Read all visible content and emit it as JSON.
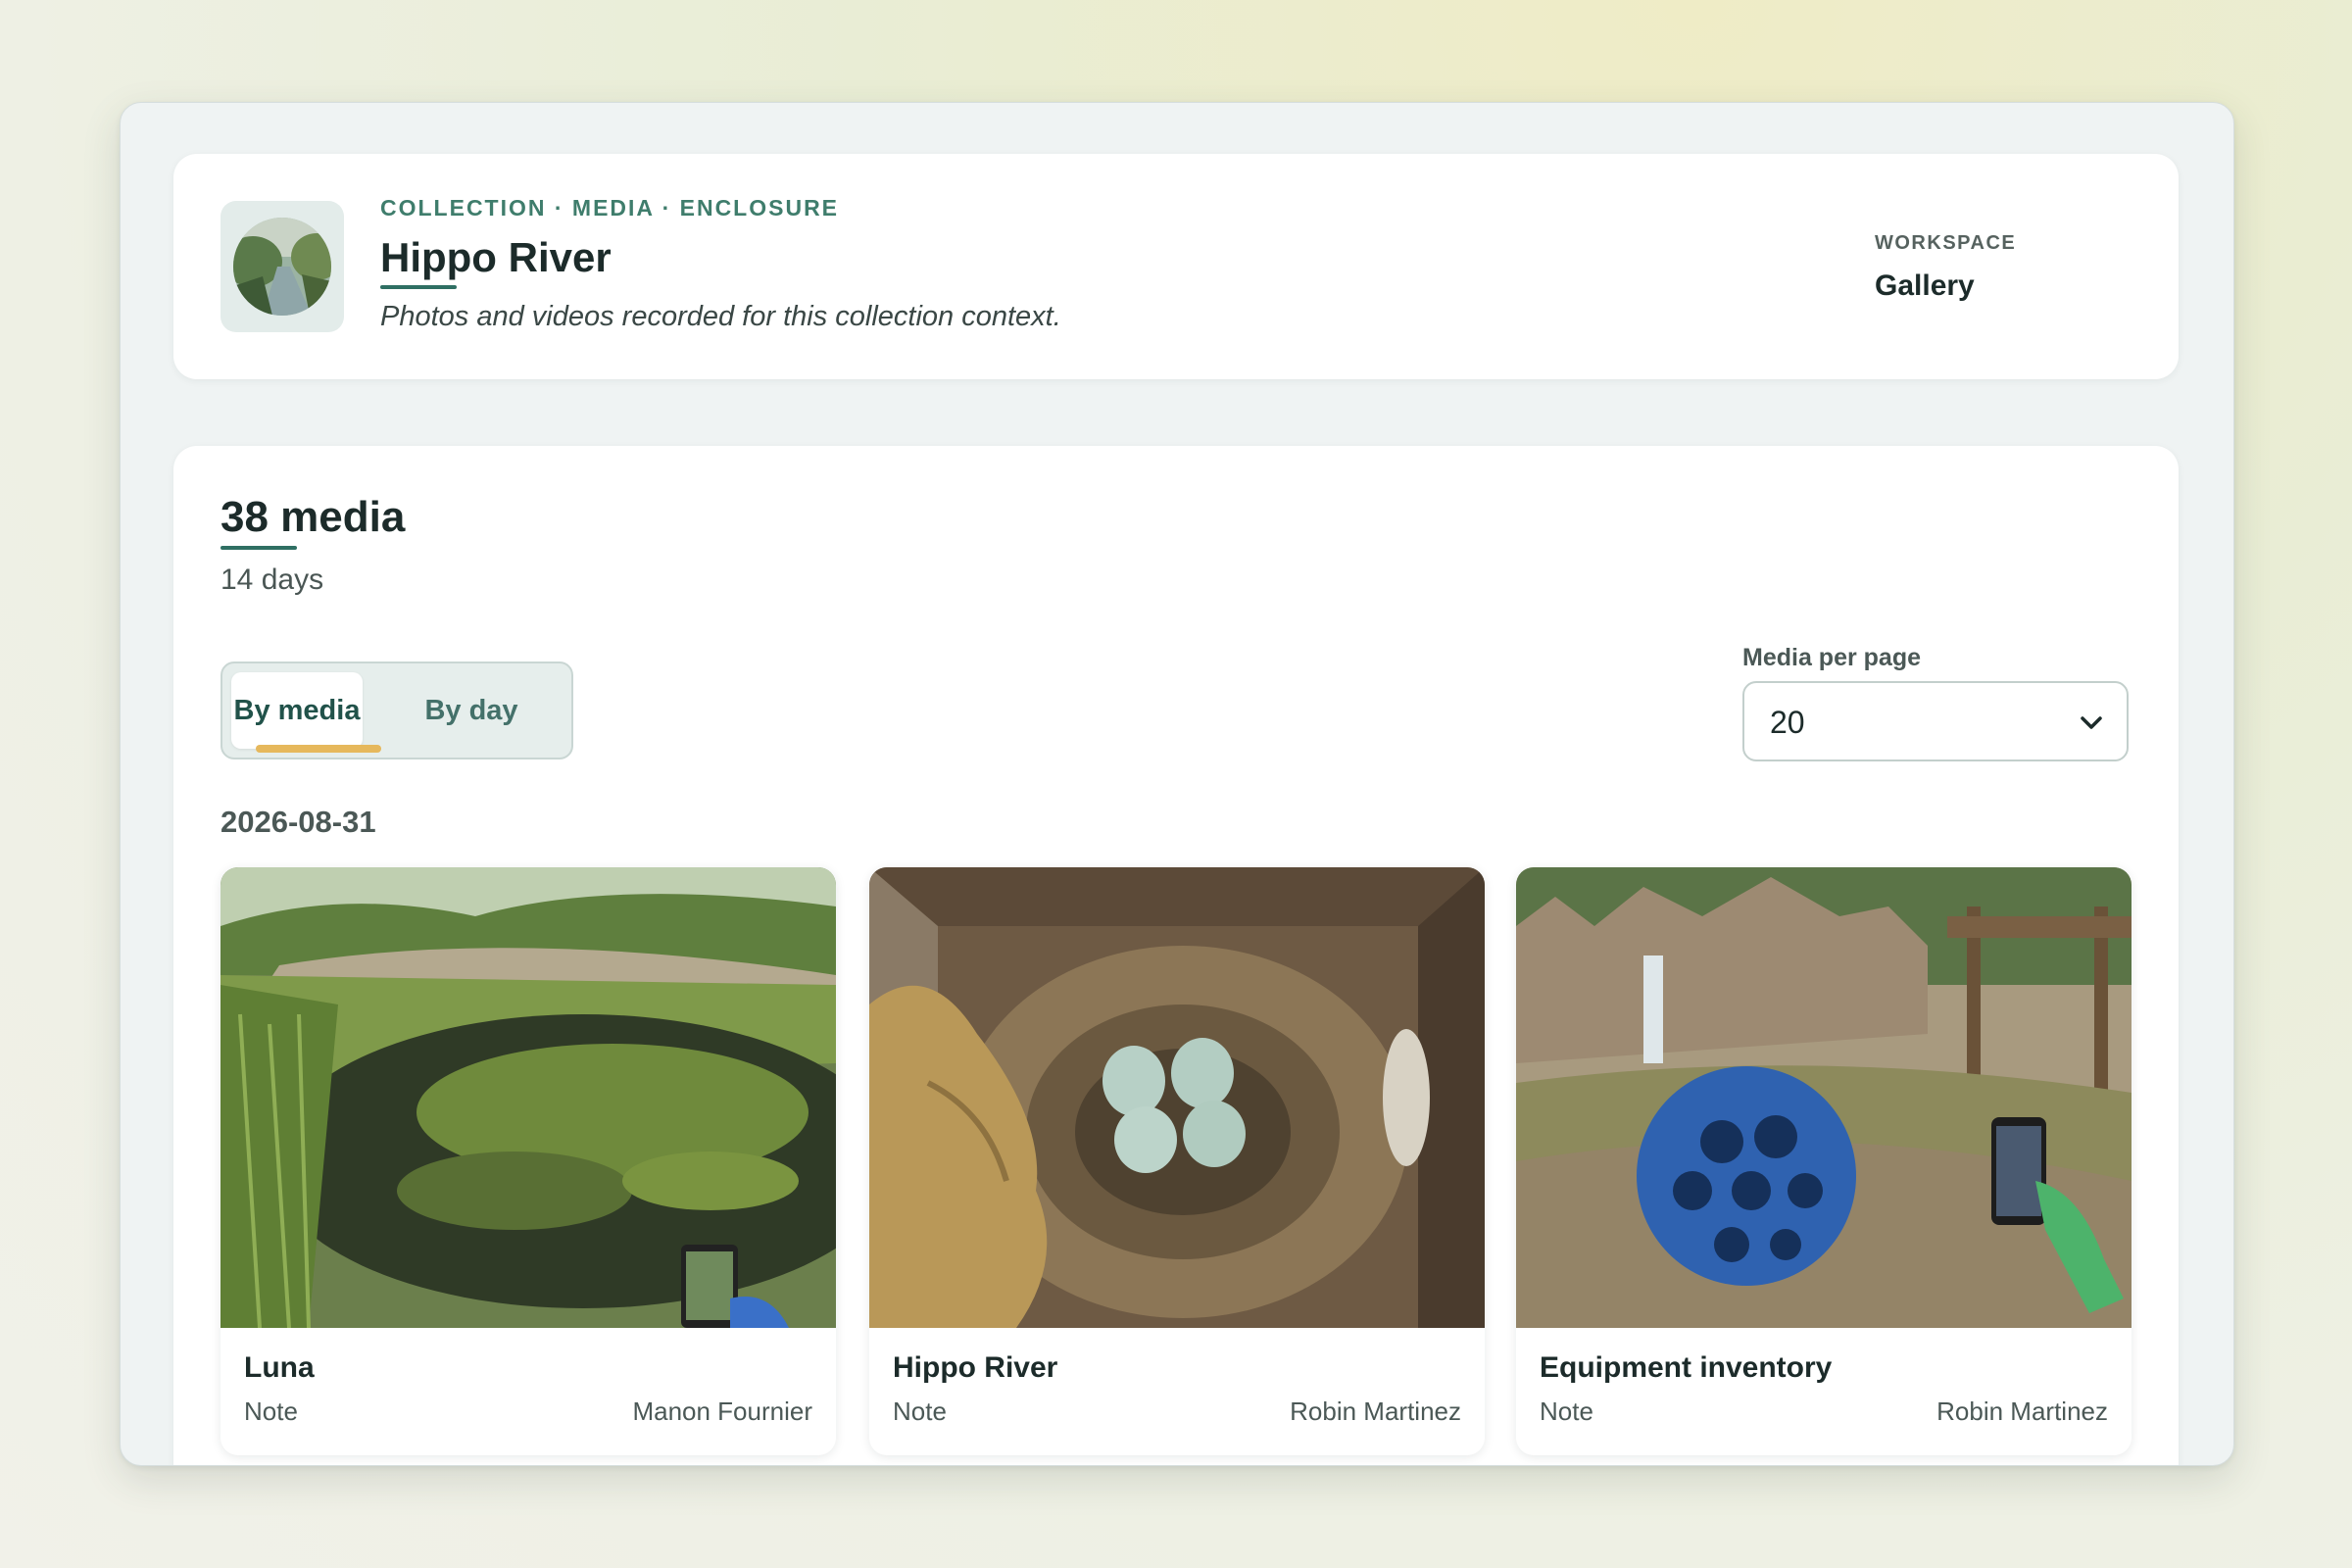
{
  "header": {
    "breadcrumb": "COLLECTION · MEDIA · ENCLOSURE",
    "title": "Hippo River",
    "subtitle": "Photos and videos recorded for this collection context.",
    "thumbnail_icon": "river-thumbnail",
    "workspace_label": "WORKSPACE",
    "workspace_value": "Gallery"
  },
  "summary": {
    "count": "38 media",
    "days": "14 days"
  },
  "view_toggle": {
    "options": [
      "By media",
      "By day"
    ],
    "selected": "By media"
  },
  "per_page": {
    "label": "Media per page",
    "value": "20",
    "icon": "chevron-down-icon"
  },
  "groups": [
    {
      "date": "2026-08-31",
      "items": [
        {
          "title": "Luna",
          "type": "Note",
          "author": "Manon Fournier",
          "image": "pond-photo"
        },
        {
          "title": "Hippo River",
          "type": "Note",
          "author": "Robin Martinez",
          "image": "nest-eggs-photo"
        },
        {
          "title": "Equipment inventory",
          "type": "Note",
          "author": "Robin Martinez",
          "image": "enrichment-ball-photo"
        }
      ]
    }
  ],
  "colors": {
    "accent": "#2f6f63",
    "eyebrow": "#3f7d6c",
    "tab_indicator": "#e6b85c"
  }
}
